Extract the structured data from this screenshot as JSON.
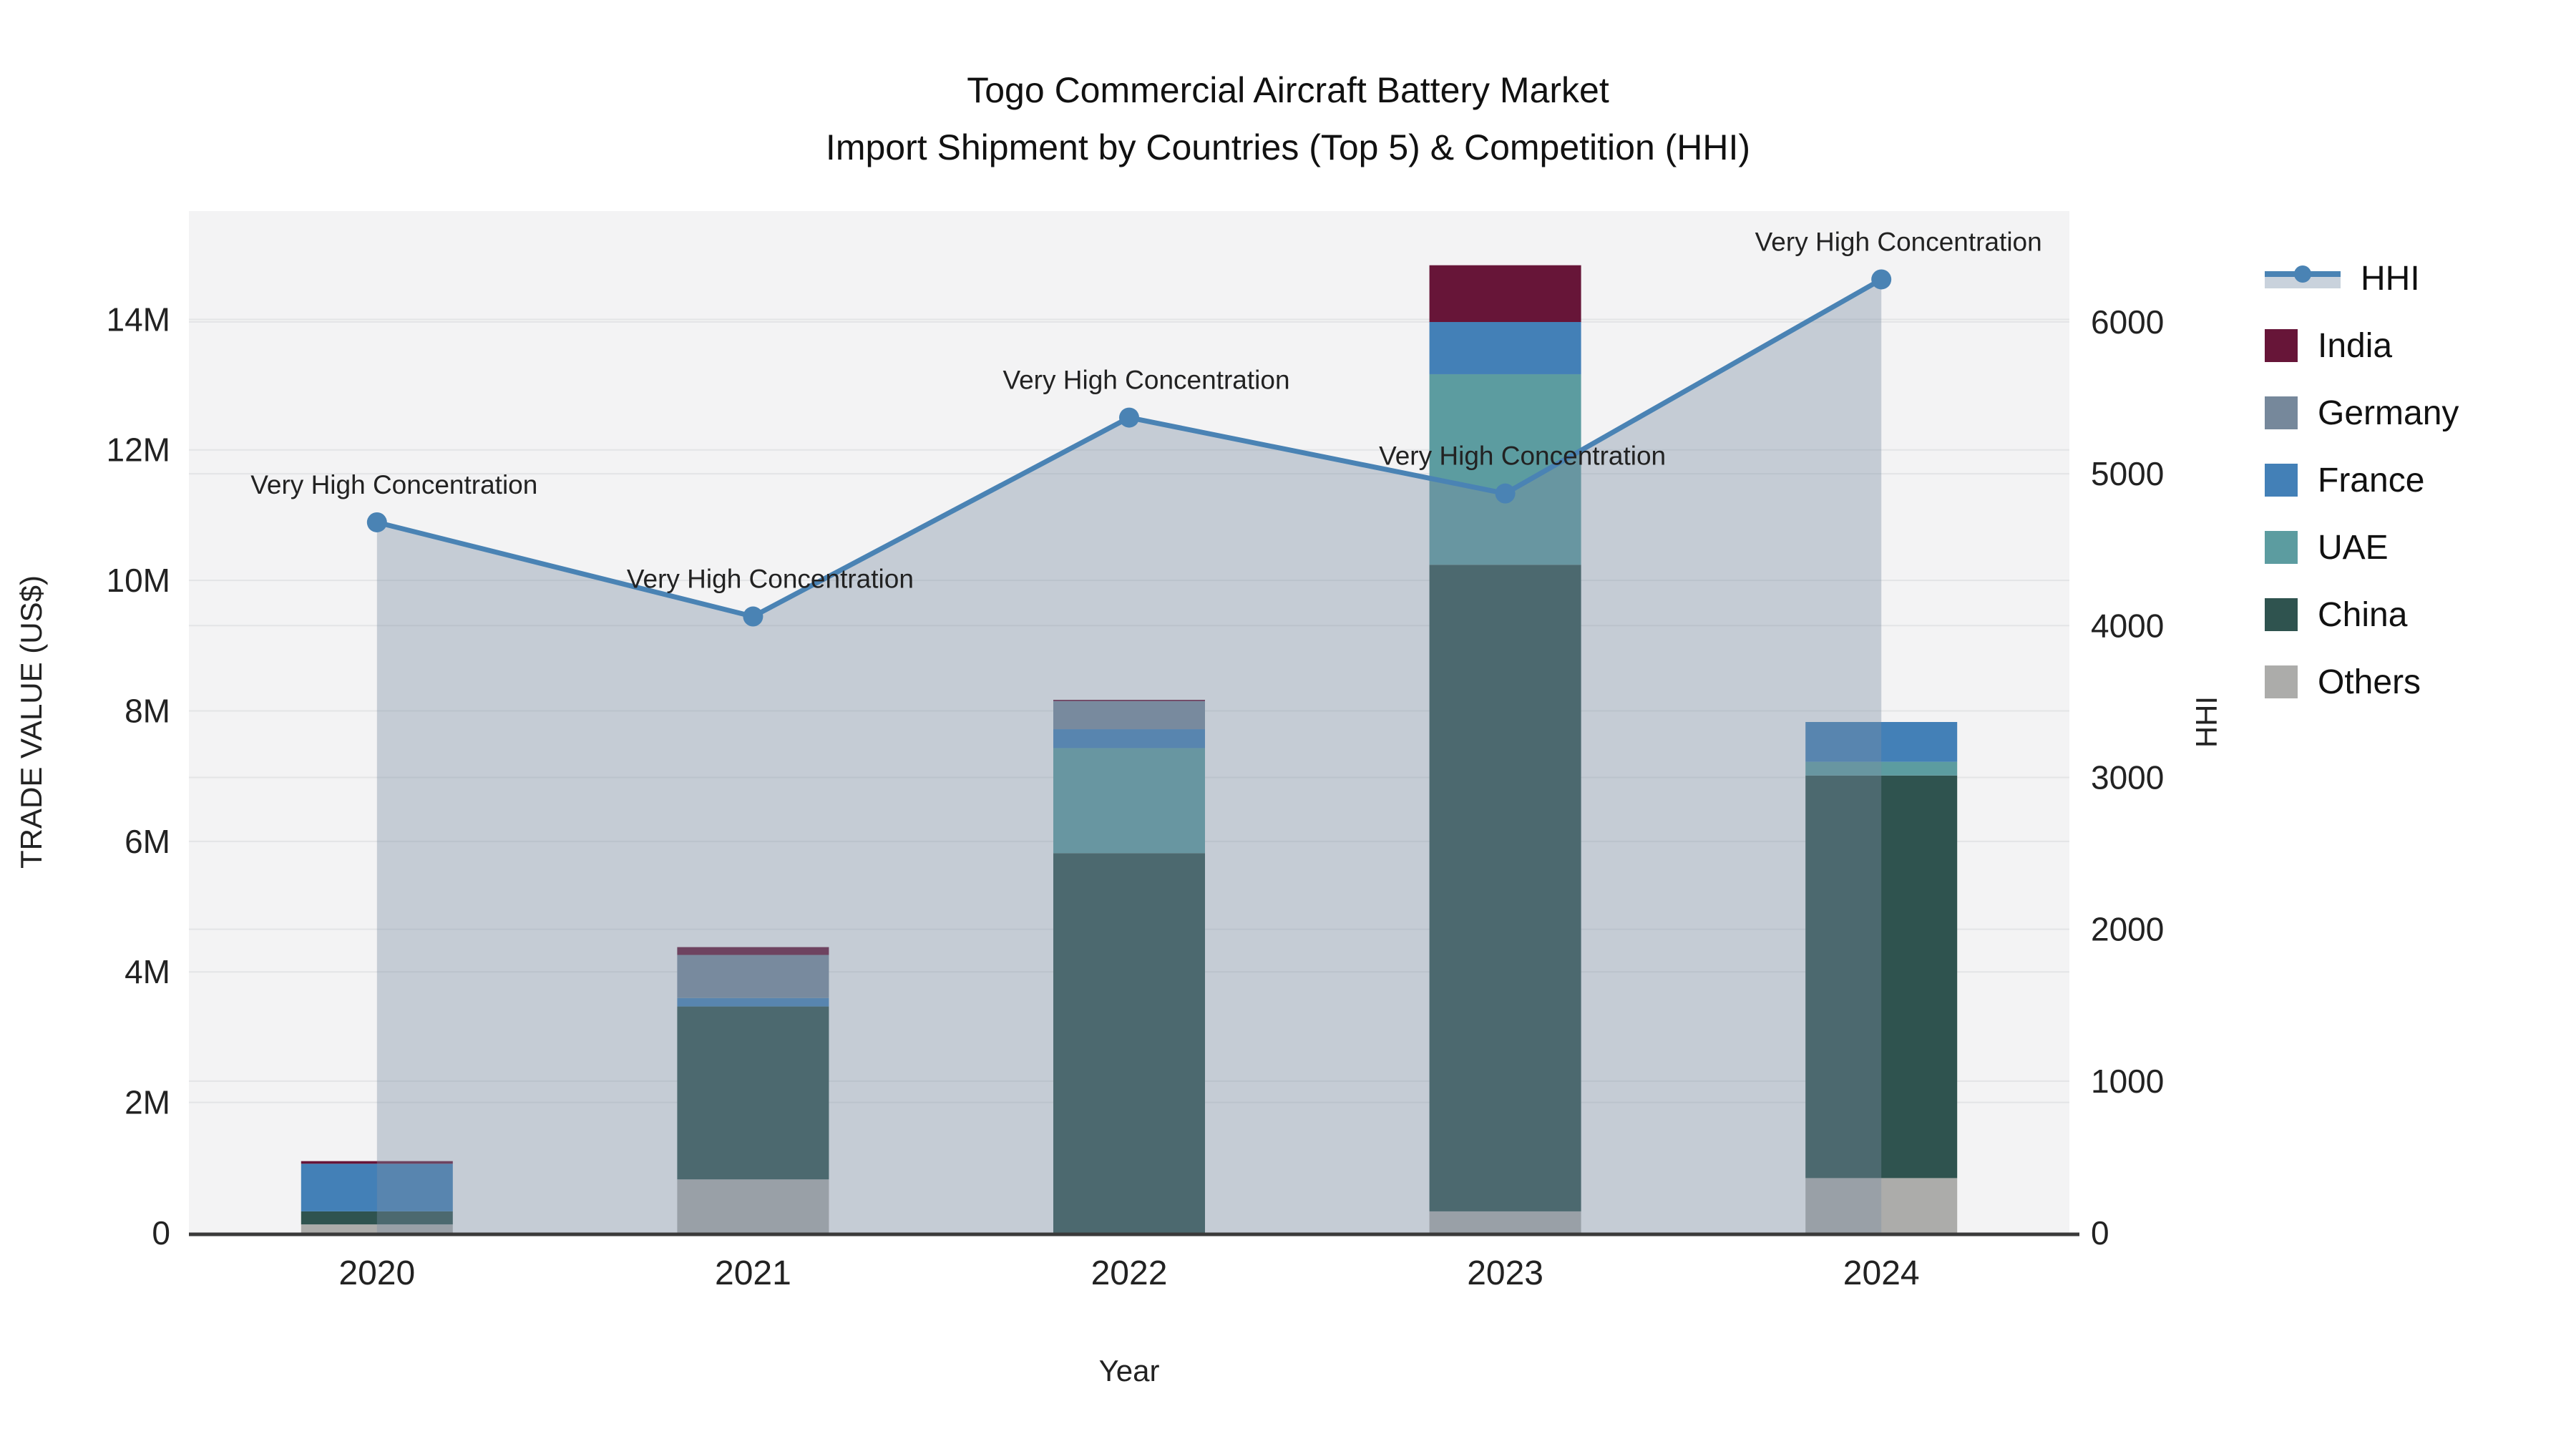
{
  "title": {
    "line1": "Togo Commercial Aircraft Battery Market",
    "line2": "Import Shipment by Countries (Top 5) & Competition (HHI)"
  },
  "legend": {
    "entries": [
      "HHI",
      "India",
      "Germany",
      "France",
      "UAE",
      "China",
      "Others"
    ]
  },
  "chart_data": {
    "type": [
      "bar",
      "line"
    ],
    "title": "Togo Commercial Aircraft Battery Market — Import Shipment by Countries (Top 5) & Competition (HHI)",
    "categories": [
      "2020",
      "2021",
      "2022",
      "2023",
      "2024"
    ],
    "xlabel": "Year",
    "y_left": {
      "label": "TRADE VALUE (US$)",
      "unit": "million USD",
      "ticks": [
        "0",
        "2M",
        "4M",
        "6M",
        "8M",
        "10M",
        "12M",
        "14M"
      ],
      "tick_values_musd": [
        0,
        2,
        4,
        6,
        8,
        10,
        12,
        14
      ],
      "max_musd": 15.66
    },
    "y_right": {
      "label": "HHI",
      "ticks": [
        "0",
        "1000",
        "2000",
        "3000",
        "4000",
        "5000",
        "6000"
      ],
      "tick_values": [
        0,
        1000,
        2000,
        3000,
        4000,
        5000,
        6000
      ],
      "max": 6730
    },
    "stack_order_bottom_to_top": [
      "Others",
      "China",
      "UAE",
      "France",
      "Germany",
      "India"
    ],
    "series": [
      {
        "name": "India",
        "color": "#671538",
        "values_musd": [
          0.04,
          0.12,
          0.02,
          0.87,
          0
        ]
      },
      {
        "name": "Germany",
        "color": "#76889B",
        "values_musd": [
          0,
          0.66,
          0.43,
          0,
          0
        ]
      },
      {
        "name": "France",
        "color": "#4380B7",
        "values_musd": [
          0.73,
          0.13,
          0.29,
          0.8,
          0.61
        ]
      },
      {
        "name": "UAE",
        "color": "#5C9CA0",
        "values_musd": [
          0,
          0,
          1.61,
          2.92,
          0.21
        ]
      },
      {
        "name": "China",
        "color": "#2F534F",
        "values_musd": [
          0.2,
          2.65,
          5.82,
          9.91,
          6.17
        ]
      },
      {
        "name": "Others",
        "color": "#ACACAA",
        "values_musd": [
          0.13,
          0.82,
          0,
          0.33,
          0.84
        ]
      }
    ],
    "totals_musd": [
      1.1,
      4.38,
      8.17,
      14.83,
      7.83
    ],
    "hhi_line": {
      "name": "HHI",
      "axis": "right",
      "color": "#4A83B4",
      "area_fill": "rgba(124,141,164,0.38)",
      "values": [
        4680,
        4060,
        5370,
        4870,
        6280
      ]
    },
    "annotations": {
      "text": "Very High Concentration",
      "applies_to": [
        "2020",
        "2021",
        "2022",
        "2023",
        "2024"
      ]
    },
    "layout": {
      "plot_background": "#f3f3f4",
      "gridline_color": "#e3e4e6",
      "axis_line_color": "#3a3a3a",
      "grid": "on",
      "legend_position": "right"
    }
  }
}
